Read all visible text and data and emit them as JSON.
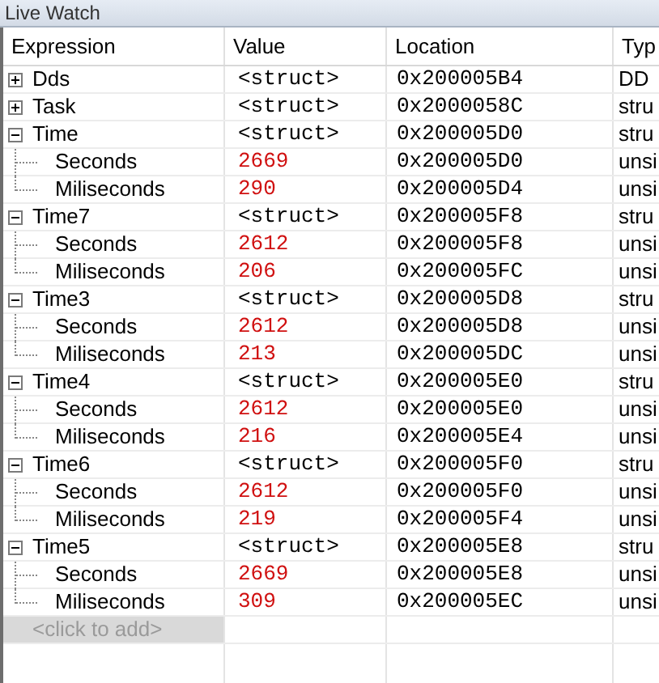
{
  "panel": {
    "title": "Live Watch"
  },
  "columns": [
    "Expression",
    "Value",
    "Location",
    "Typ"
  ],
  "rows": [
    {
      "expression": "Dds",
      "value": "<struct>",
      "location": "0x200005B4",
      "type": "DD",
      "expanded": false
    },
    {
      "expression": "Task",
      "value": "<struct>",
      "location": "0x2000058C",
      "type": "stru",
      "expanded": false
    },
    {
      "expression": "Time",
      "value": "<struct>",
      "location": "0x200005D0",
      "type": "stru",
      "expanded": true,
      "children": [
        {
          "expression": "Seconds",
          "value": "2669",
          "location": "0x200005D0",
          "type": "unsi",
          "changed": true
        },
        {
          "expression": "Miliseconds",
          "value": "290",
          "location": "0x200005D4",
          "type": "unsi",
          "changed": true
        }
      ]
    },
    {
      "expression": "Time7",
      "value": "<struct>",
      "location": "0x200005F8",
      "type": "stru",
      "expanded": true,
      "children": [
        {
          "expression": "Seconds",
          "value": "2612",
          "location": "0x200005F8",
          "type": "unsi",
          "changed": true
        },
        {
          "expression": "Miliseconds",
          "value": "206",
          "location": "0x200005FC",
          "type": "unsi",
          "changed": true
        }
      ]
    },
    {
      "expression": "Time3",
      "value": "<struct>",
      "location": "0x200005D8",
      "type": "stru",
      "expanded": true,
      "children": [
        {
          "expression": "Seconds",
          "value": "2612",
          "location": "0x200005D8",
          "type": "unsi",
          "changed": true
        },
        {
          "expression": "Miliseconds",
          "value": "213",
          "location": "0x200005DC",
          "type": "unsi",
          "changed": true
        }
      ]
    },
    {
      "expression": "Time4",
      "value": "<struct>",
      "location": "0x200005E0",
      "type": "stru",
      "expanded": true,
      "children": [
        {
          "expression": "Seconds",
          "value": "2612",
          "location": "0x200005E0",
          "type": "unsi",
          "changed": true
        },
        {
          "expression": "Miliseconds",
          "value": "216",
          "location": "0x200005E4",
          "type": "unsi",
          "changed": true
        }
      ]
    },
    {
      "expression": "Time6",
      "value": "<struct>",
      "location": "0x200005F0",
      "type": "stru",
      "expanded": true,
      "children": [
        {
          "expression": "Seconds",
          "value": "2612",
          "location": "0x200005F0",
          "type": "unsi",
          "changed": true
        },
        {
          "expression": "Miliseconds",
          "value": "219",
          "location": "0x200005F4",
          "type": "unsi",
          "changed": true
        }
      ]
    },
    {
      "expression": "Time5",
      "value": "<struct>",
      "location": "0x200005E8",
      "type": "stru",
      "expanded": true,
      "children": [
        {
          "expression": "Seconds",
          "value": "2669",
          "location": "0x200005E8",
          "type": "unsi",
          "changed": true
        },
        {
          "expression": "Miliseconds",
          "value": "309",
          "location": "0x200005EC",
          "type": "unsi",
          "changed": true
        }
      ]
    }
  ],
  "add_row": "<click to add>"
}
